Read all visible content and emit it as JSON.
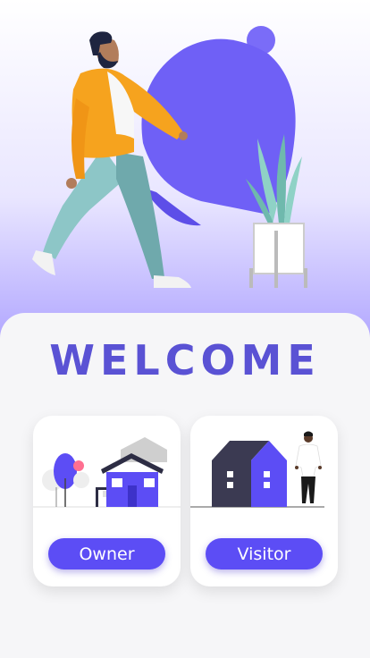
{
  "header": {
    "title": "WELCOME"
  },
  "cards": [
    {
      "label": "Owner",
      "illustration": "house-icon"
    },
    {
      "label": "Visitor",
      "illustration": "visitor-icon"
    }
  ],
  "colors": {
    "accent": "#5c4df5",
    "title": "#5a52d4",
    "sheet": "#f6f6f8"
  }
}
